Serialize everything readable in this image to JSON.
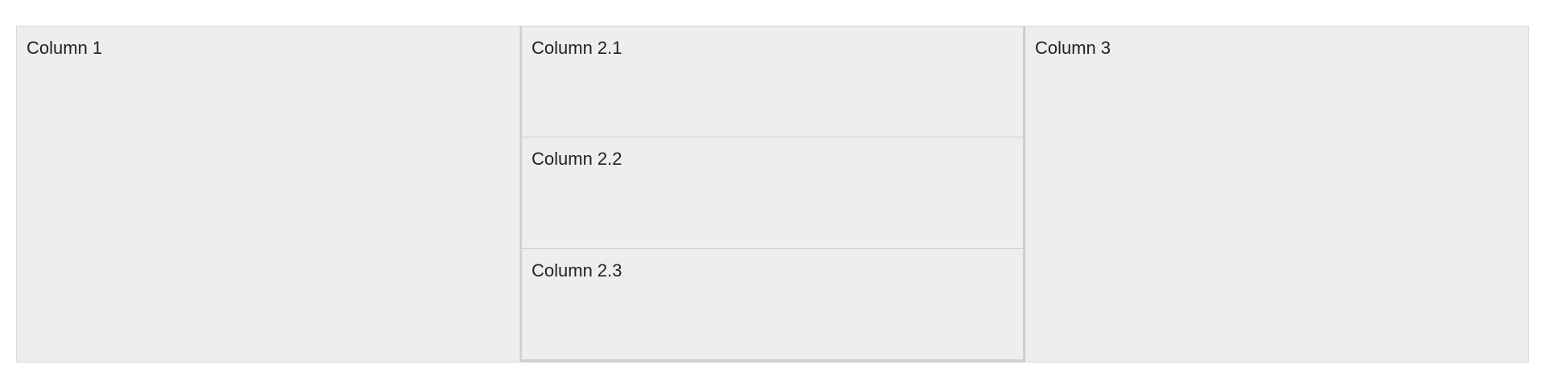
{
  "columns": {
    "col1": {
      "label": "Column 1"
    },
    "col2": {
      "items": [
        {
          "label": "Column 2.1"
        },
        {
          "label": "Column 2.2"
        },
        {
          "label": "Column 2.3"
        }
      ]
    },
    "col3": {
      "label": "Column 3"
    }
  },
  "colors": {
    "background": "#ffffff",
    "cell": "#eeeeee",
    "border": "#d9d9d9",
    "text": "#222222"
  }
}
